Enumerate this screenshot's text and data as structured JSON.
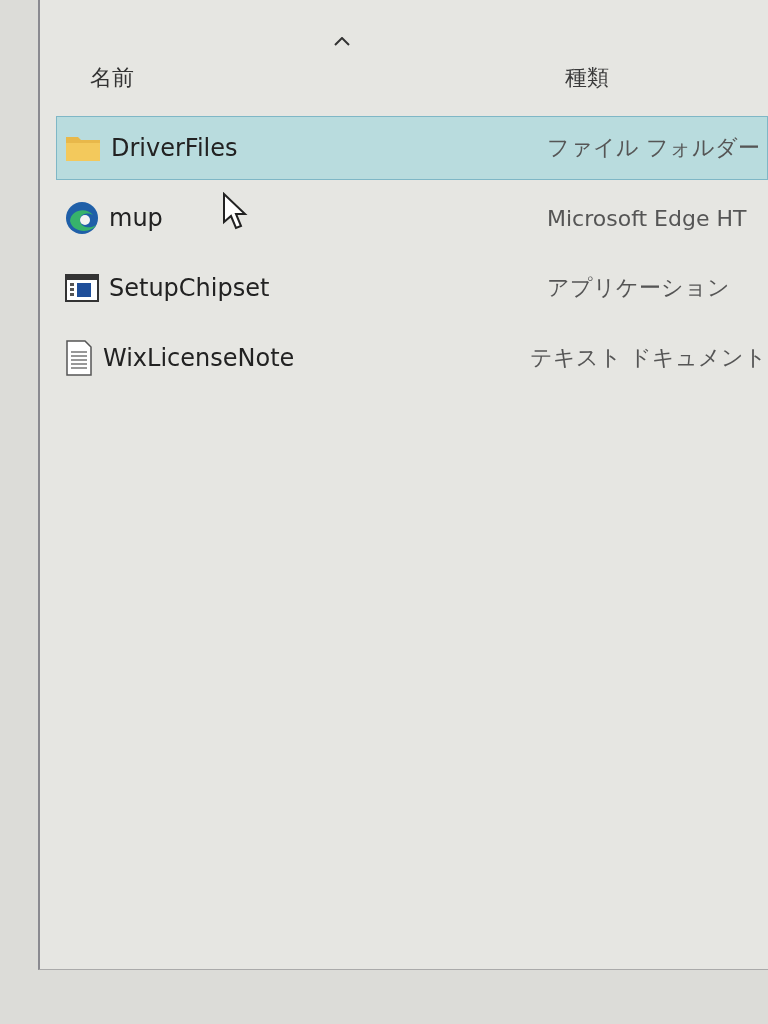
{
  "file_list": {
    "columns": [
      {
        "label": "名前",
        "sorted": true
      },
      {
        "label": "種類",
        "sorted": false
      }
    ],
    "rows": [
      {
        "name": "DriverFiles",
        "type": "ファイル フォルダー",
        "kind": "folder",
        "selected": true
      },
      {
        "name": "mup",
        "type": "Microsoft Edge HT",
        "kind": "edge",
        "selected": false
      },
      {
        "name": "SetupChipset",
        "type": "アプリケーション",
        "kind": "app",
        "selected": false
      },
      {
        "name": "WixLicenseNote",
        "type": "テキスト ドキュメント",
        "kind": "text",
        "selected": false
      }
    ]
  }
}
